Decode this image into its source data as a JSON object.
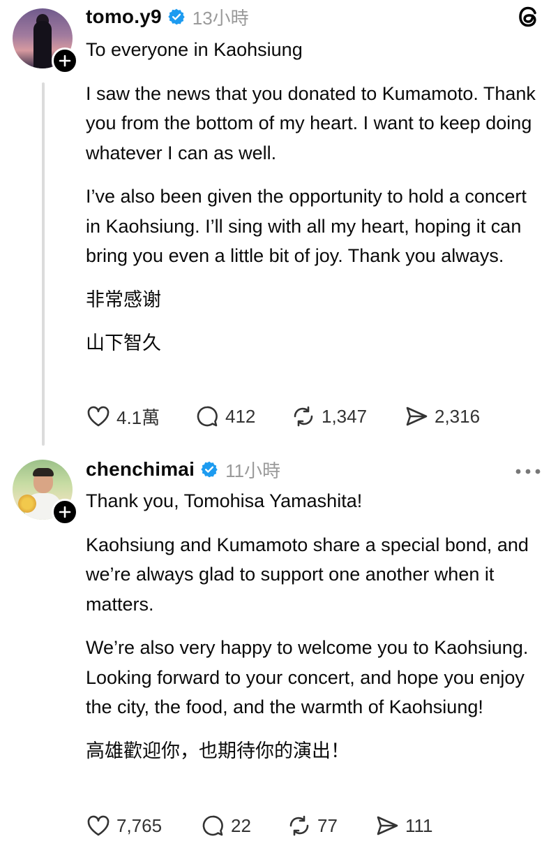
{
  "posts": [
    {
      "username": "tomo.y9",
      "verified": true,
      "time": "13小時",
      "top_right_icon": "threads-logo-icon",
      "paragraphs": [
        "To everyone in Kaohsiung",
        "I saw the news that you donated to Kumamoto. Thank you from the bottom of my heart. I want to keep doing whatever I can as well.",
        "I’ve also been given the opportunity to hold a concert in Kaohsiung. I’ll sing with all my heart, hoping it can bring you even a little bit of joy. Thank you always.",
        "非常感谢",
        "山下智久"
      ],
      "stats": {
        "likes": "4.1萬",
        "replies": "412",
        "reposts": "1,347",
        "shares": "2,316"
      }
    },
    {
      "username": "chenchimai",
      "verified": true,
      "time": "11小時",
      "top_right_icon": "more-options-icon",
      "paragraphs": [
        "Thank you, Tomohisa Yamashita!",
        "Kaohsiung and Kumamoto share a special bond, and we’re always glad to support one another when it matters.",
        "We’re also very happy to welcome you to Kaohsiung. Looking forward to your concert, and hope you enjoy the city, the food, and the warmth of Kaohsiung!",
        "高雄歡迎你，也期待你的演出！"
      ],
      "stats": {
        "likes": "7,765",
        "replies": "22",
        "reposts": "77",
        "shares": "111"
      }
    }
  ],
  "colors": {
    "verified": "#1d9bf0",
    "timestamp": "#9a9a9a",
    "thread_line": "#dcdcdc",
    "text": "#0a0a0a"
  }
}
